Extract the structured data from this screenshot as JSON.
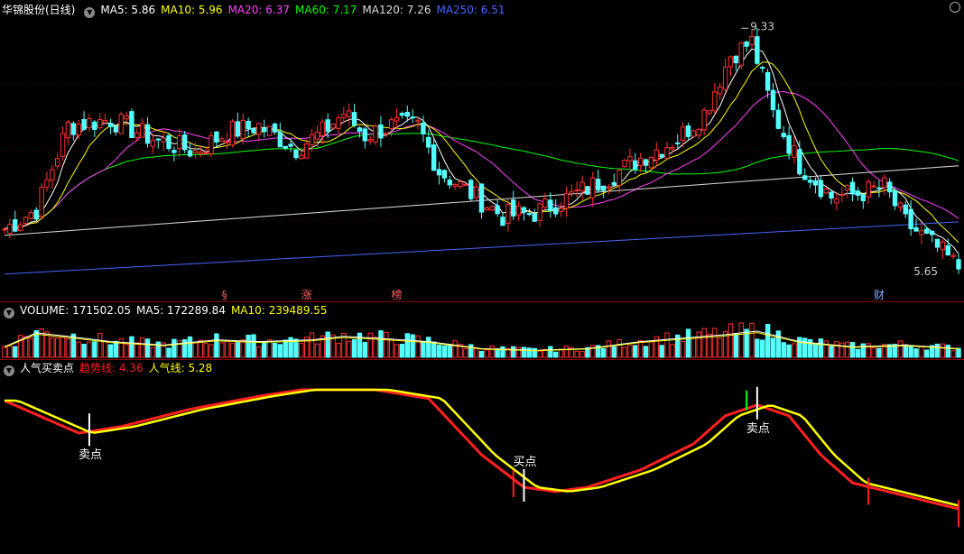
{
  "header": {
    "stock_title": "华锦股份(日线)",
    "ma_labels": [
      {
        "text": "MA5: 5.86",
        "color": "#ffffff"
      },
      {
        "text": "MA10: 5.96",
        "color": "#ffff00"
      },
      {
        "text": "MA20: 6.37",
        "color": "#ff44ff"
      },
      {
        "text": "MA60: 7.17",
        "color": "#00ff00"
      },
      {
        "text": "MA120: 7.26",
        "color": "#dddddd"
      },
      {
        "text": "MA250: 6.51",
        "color": "#4466ff"
      }
    ]
  },
  "volume_header": {
    "labels": [
      {
        "text": "VOLUME: 171502.05",
        "color": "#ffffff"
      },
      {
        "text": "MA5: 172289.84",
        "color": "#ffffff"
      },
      {
        "text": "MA10: 239489.55",
        "color": "#ffff00"
      }
    ]
  },
  "indicator_header": {
    "name": "人气买卖点",
    "labels": [
      {
        "text": "趋势线: 4.36",
        "color": "#ff2020"
      },
      {
        "text": "人气线: 5.28",
        "color": "#ffff00"
      }
    ]
  },
  "annotations": {
    "high_label": "9.33",
    "low_label": "5.65",
    "event_markers": [
      "§",
      "涨",
      "榜",
      "财"
    ],
    "signals": [
      "卖点",
      "买点",
      "卖点"
    ]
  },
  "colors": {
    "up": "#ff3030",
    "down": "#55ffff",
    "ma5": "#ffffff",
    "ma10": "#ffff00",
    "ma20": "#ff44ff",
    "ma60": "#00ff00",
    "ma120": "#dddddd",
    "ma250": "#4466ff",
    "trend": "#ff2020",
    "popularity": "#ffff00"
  },
  "chart_data": {
    "type": "candlestick",
    "price_anchors": [
      [
        0,
        6.3
      ],
      [
        6,
        6.6
      ],
      [
        12,
        7.9
      ],
      [
        20,
        8.0
      ],
      [
        28,
        7.7
      ],
      [
        36,
        7.5
      ],
      [
        42,
        7.8
      ],
      [
        48,
        7.9
      ],
      [
        55,
        7.55
      ],
      [
        60,
        7.8
      ],
      [
        64,
        8.1
      ],
      [
        68,
        7.75
      ],
      [
        73,
        7.9
      ],
      [
        78,
        7.9
      ],
      [
        82,
        7.2
      ],
      [
        88,
        6.85
      ],
      [
        94,
        6.5
      ],
      [
        100,
        6.55
      ],
      [
        108,
        6.85
      ],
      [
        114,
        7.1
      ],
      [
        120,
        7.4
      ],
      [
        127,
        7.7
      ],
      [
        132,
        8.1
      ],
      [
        137,
        9.0
      ],
      [
        141,
        9.2
      ],
      [
        145,
        8.1
      ],
      [
        150,
        7.3
      ],
      [
        156,
        6.8
      ],
      [
        161,
        6.85
      ],
      [
        166,
        6.95
      ],
      [
        170,
        6.4
      ],
      [
        176,
        6.0
      ],
      [
        180,
        5.7
      ]
    ],
    "volume_anchors": [
      [
        0,
        0.3
      ],
      [
        6,
        0.7
      ],
      [
        12,
        0.6
      ],
      [
        20,
        0.45
      ],
      [
        30,
        0.35
      ],
      [
        40,
        0.5
      ],
      [
        48,
        0.45
      ],
      [
        58,
        0.5
      ],
      [
        64,
        0.6
      ],
      [
        70,
        0.55
      ],
      [
        80,
        0.45
      ],
      [
        90,
        0.25
      ],
      [
        100,
        0.2
      ],
      [
        110,
        0.25
      ],
      [
        120,
        0.45
      ],
      [
        128,
        0.55
      ],
      [
        136,
        0.65
      ],
      [
        142,
        0.75
      ],
      [
        150,
        0.45
      ],
      [
        160,
        0.3
      ],
      [
        170,
        0.35
      ],
      [
        180,
        0.25
      ]
    ],
    "trend_anchors": [
      [
        0,
        5.65
      ],
      [
        14,
        5.5
      ],
      [
        22,
        5.53
      ],
      [
        35,
        5.61
      ],
      [
        48,
        5.67
      ],
      [
        56,
        5.7
      ],
      [
        70,
        5.7
      ],
      [
        80,
        5.66
      ],
      [
        90,
        5.4
      ],
      [
        98,
        5.25
      ],
      [
        104,
        5.23
      ],
      [
        110,
        5.25
      ],
      [
        120,
        5.33
      ],
      [
        130,
        5.45
      ],
      [
        136,
        5.58
      ],
      [
        142,
        5.63
      ],
      [
        148,
        5.58
      ],
      [
        154,
        5.4
      ],
      [
        160,
        5.27
      ],
      [
        170,
        5.21
      ],
      [
        180,
        5.15
      ]
    ],
    "signal_indices": {
      "sell": [
        16,
        142
      ],
      "buy": [
        98
      ]
    },
    "event_marker_indices": [
      42,
      57,
      74,
      165
    ],
    "price_range": [
      5.4,
      9.6
    ],
    "volume_range": [
      0,
      1.0
    ],
    "indicator_range": [
      5.0,
      5.75
    ]
  }
}
